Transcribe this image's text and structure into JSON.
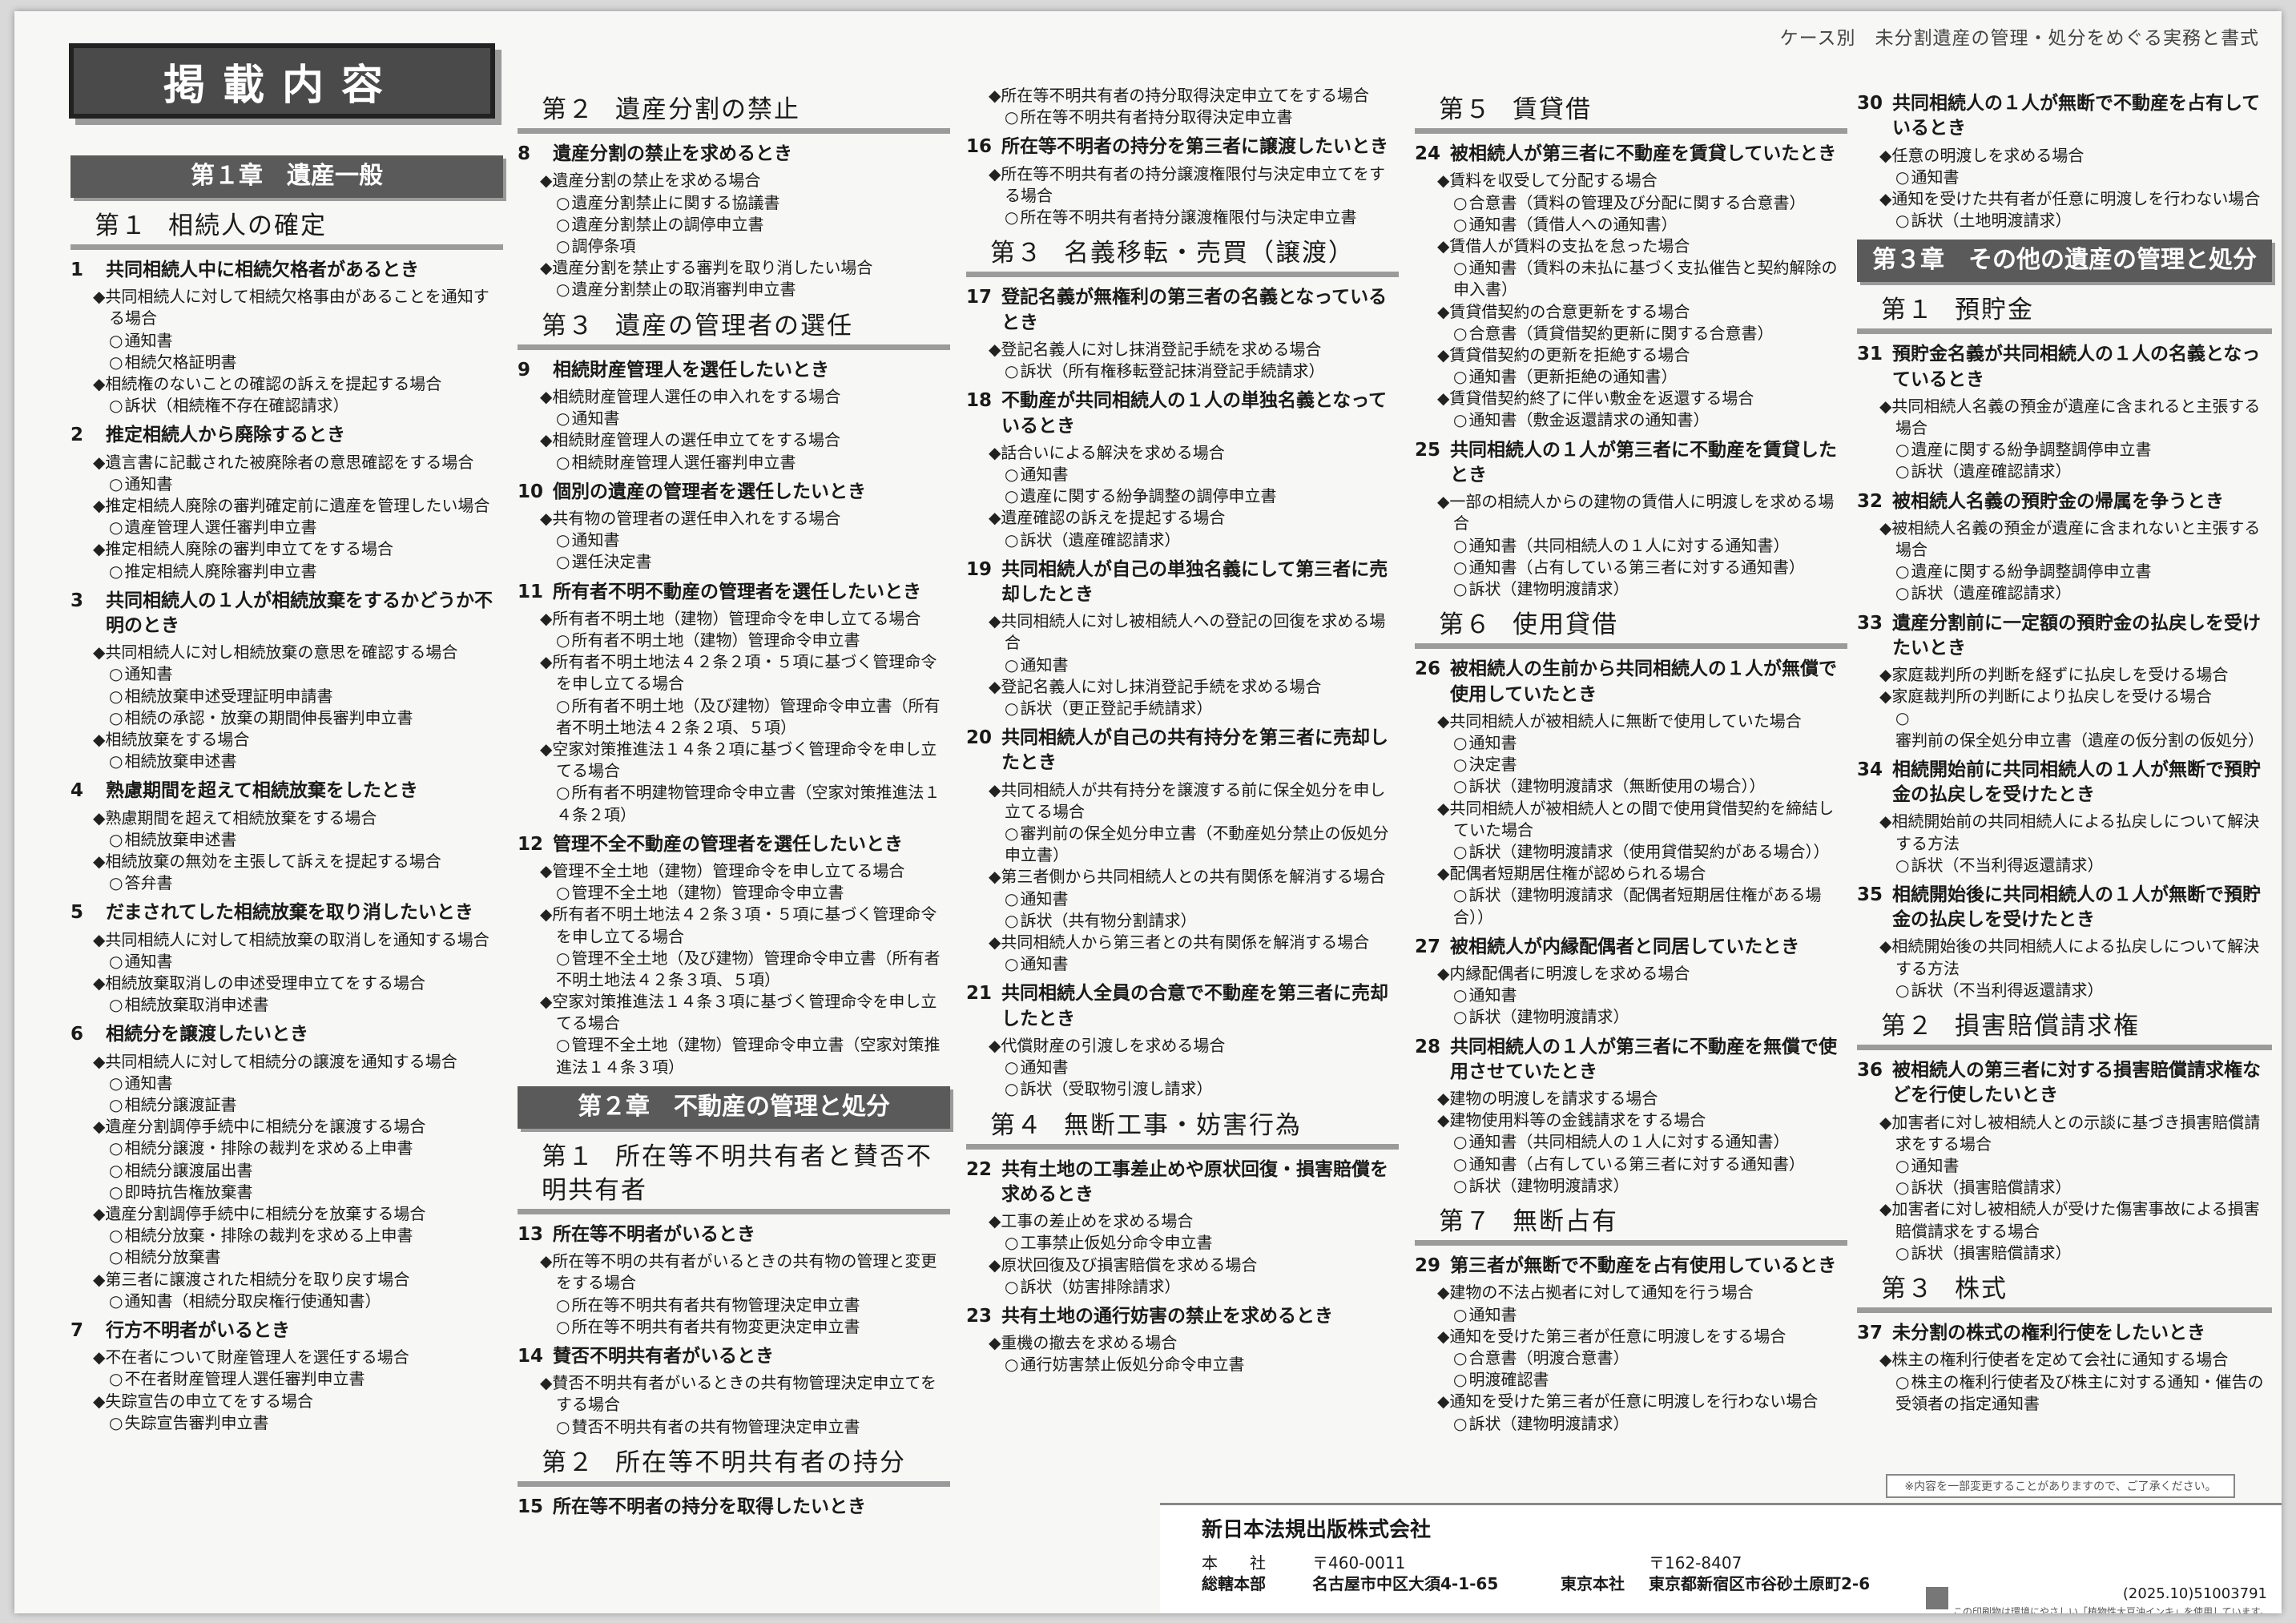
{
  "header": {
    "running_title": "ケース別　未分割遺産の管理・処分をめぐる実務と書式",
    "contents_title": "掲載内容"
  },
  "columns": [
    [
      {
        "type": "chapter",
        "text": "第１章　遺産一般"
      },
      {
        "type": "section",
        "num": "第１",
        "text": "相続人の確定"
      },
      {
        "type": "topic",
        "no": "1",
        "text": "共同相続人中に相続欠格者があるとき"
      },
      {
        "type": "item",
        "text": "共同相続人に対して相続欠格事由があることを通知する場合"
      },
      {
        "type": "doc",
        "text": "通知書"
      },
      {
        "type": "doc",
        "text": "相続欠格証明書"
      },
      {
        "type": "item",
        "text": "相続権のないことの確認の訴えを提起する場合"
      },
      {
        "type": "doc",
        "text": "訴状（相続権不存在確認請求）"
      },
      {
        "type": "topic",
        "no": "2",
        "text": "推定相続人から廃除するとき"
      },
      {
        "type": "item",
        "text": "遺言書に記載された被廃除者の意思確認をする場合"
      },
      {
        "type": "doc",
        "text": "通知書"
      },
      {
        "type": "item",
        "text": "推定相続人廃除の審判確定前に遺産を管理したい場合"
      },
      {
        "type": "doc",
        "text": "遺産管理人選任審判申立書"
      },
      {
        "type": "item",
        "text": "推定相続人廃除の審判申立てをする場合"
      },
      {
        "type": "doc",
        "text": "推定相続人廃除審判申立書"
      },
      {
        "type": "topic",
        "no": "3",
        "text": "共同相続人の１人が相続放棄をするかどうか不明のとき"
      },
      {
        "type": "item",
        "text": "共同相続人に対し相続放棄の意思を確認する場合"
      },
      {
        "type": "doc",
        "text": "通知書"
      },
      {
        "type": "doc",
        "text": "相続放棄申述受理証明申請書"
      },
      {
        "type": "doc",
        "text": "相続の承認・放棄の期間伸長審判申立書"
      },
      {
        "type": "item",
        "text": "相続放棄をする場合"
      },
      {
        "type": "doc",
        "text": "相続放棄申述書"
      },
      {
        "type": "topic",
        "no": "4",
        "text": "熟慮期間を超えて相続放棄をしたとき"
      },
      {
        "type": "item",
        "text": "熟慮期間を超えて相続放棄をする場合"
      },
      {
        "type": "doc",
        "text": "相続放棄申述書"
      },
      {
        "type": "item",
        "text": "相続放棄の無効を主張して訴えを提起する場合"
      },
      {
        "type": "doc",
        "text": "答弁書"
      },
      {
        "type": "topic",
        "no": "5",
        "text": "だまされてした相続放棄を取り消したいとき"
      },
      {
        "type": "item",
        "text": "共同相続人に対して相続放棄の取消しを通知する場合"
      },
      {
        "type": "doc",
        "text": "通知書"
      },
      {
        "type": "item",
        "text": "相続放棄取消しの申述受理申立てをする場合"
      },
      {
        "type": "doc",
        "text": "相続放棄取消申述書"
      },
      {
        "type": "topic",
        "no": "6",
        "text": "相続分を譲渡したいとき"
      },
      {
        "type": "item",
        "text": "共同相続人に対して相続分の譲渡を通知する場合"
      },
      {
        "type": "doc",
        "text": "通知書"
      },
      {
        "type": "doc",
        "text": "相続分譲渡証書"
      },
      {
        "type": "item",
        "text": "遺産分割調停手続中に相続分を譲渡する場合"
      },
      {
        "type": "doc",
        "text": "相続分譲渡・排除の裁判を求める上申書"
      },
      {
        "type": "doc",
        "text": "相続分譲渡届出書"
      },
      {
        "type": "doc",
        "text": "即時抗告権放棄書"
      },
      {
        "type": "item",
        "text": "遺産分割調停手続中に相続分を放棄する場合"
      },
      {
        "type": "doc",
        "text": "相続分放棄・排除の裁判を求める上申書"
      },
      {
        "type": "doc",
        "text": "相続分放棄書"
      },
      {
        "type": "item",
        "text": "第三者に譲渡された相続分を取り戻す場合"
      },
      {
        "type": "doc",
        "text": "通知書（相続分取戻権行使通知書）"
      },
      {
        "type": "topic",
        "no": "7",
        "text": "行方不明者がいるとき"
      },
      {
        "type": "item",
        "text": "不在者について財産管理人を選任する場合"
      },
      {
        "type": "doc",
        "text": "不在者財産管理人選任審判申立書"
      },
      {
        "type": "item",
        "text": "失踪宣告の申立てをする場合"
      },
      {
        "type": "doc",
        "text": "失踪宣告審判申立書"
      }
    ],
    [
      {
        "type": "section",
        "num": "第２",
        "text": "遺産分割の禁止"
      },
      {
        "type": "topic",
        "no": "8",
        "text": "遺産分割の禁止を求めるとき"
      },
      {
        "type": "item",
        "text": "遺産分割の禁止を求める場合"
      },
      {
        "type": "doc",
        "text": "遺産分割禁止に関する協議書"
      },
      {
        "type": "doc",
        "text": "遺産分割禁止の調停申立書"
      },
      {
        "type": "doc",
        "text": "調停条項"
      },
      {
        "type": "item",
        "text": "遺産分割を禁止する審判を取り消したい場合"
      },
      {
        "type": "doc",
        "text": "遺産分割禁止の取消審判申立書"
      },
      {
        "type": "section",
        "num": "第３",
        "text": "遺産の管理者の選任"
      },
      {
        "type": "topic",
        "no": "9",
        "text": "相続財産管理人を選任したいとき"
      },
      {
        "type": "item",
        "text": "相続財産管理人選任の申入れをする場合"
      },
      {
        "type": "doc",
        "text": "通知書"
      },
      {
        "type": "item",
        "text": "相続財産管理人の選任申立てをする場合"
      },
      {
        "type": "doc",
        "text": "相続財産管理人選任審判申立書"
      },
      {
        "type": "topic",
        "no": "10",
        "text": "個別の遺産の管理者を選任したいとき"
      },
      {
        "type": "item",
        "text": "共有物の管理者の選任申入れをする場合"
      },
      {
        "type": "doc",
        "text": "通知書"
      },
      {
        "type": "doc",
        "text": "選任決定書"
      },
      {
        "type": "topic",
        "no": "11",
        "text": "所有者不明不動産の管理者を選任したいとき"
      },
      {
        "type": "item",
        "text": "所有者不明土地（建物）管理命令を申し立てる場合"
      },
      {
        "type": "doc",
        "text": "所有者不明土地（建物）管理命令申立書"
      },
      {
        "type": "item",
        "text": "所有者不明土地法４２条２項・５項に基づく管理命令を申し立てる場合"
      },
      {
        "type": "doc",
        "text": "所有者不明土地（及び建物）管理命令申立書（所有者不明土地法４２条２項、５項）"
      },
      {
        "type": "item",
        "text": "空家対策推進法１４条２項に基づく管理命令を申し立てる場合"
      },
      {
        "type": "doc",
        "text": "所有者不明建物管理命令申立書（空家対策推進法１４条２項）"
      },
      {
        "type": "topic",
        "no": "12",
        "text": "管理不全不動産の管理者を選任したいとき"
      },
      {
        "type": "item",
        "text": "管理不全土地（建物）管理命令を申し立てる場合"
      },
      {
        "type": "doc",
        "text": "管理不全土地（建物）管理命令申立書"
      },
      {
        "type": "item",
        "text": "所有者不明土地法４２条３項・５項に基づく管理命令を申し立てる場合"
      },
      {
        "type": "doc",
        "text": "管理不全土地（及び建物）管理命令申立書（所有者不明土地法４２条３項、５項）"
      },
      {
        "type": "item",
        "text": "空家対策推進法１４条３項に基づく管理命令を申し立てる場合"
      },
      {
        "type": "doc",
        "text": "管理不全土地（建物）管理命令申立書（空家対策推進法１４条３項）"
      },
      {
        "type": "chapter",
        "text": "第２章　不動産の管理と処分"
      },
      {
        "type": "section",
        "num": "第１",
        "text": "所在等不明共有者と賛否不明共有者"
      },
      {
        "type": "topic",
        "no": "13",
        "text": "所在等不明者がいるとき"
      },
      {
        "type": "item",
        "text": "所在等不明の共有者がいるときの共有物の管理と変更をする場合"
      },
      {
        "type": "doc",
        "text": "所在等不明共有者共有物管理決定申立書"
      },
      {
        "type": "doc",
        "text": "所在等不明共有者共有物変更決定申立書"
      },
      {
        "type": "topic",
        "no": "14",
        "text": "賛否不明共有者がいるとき"
      },
      {
        "type": "item",
        "text": "賛否不明共有者がいるときの共有物管理決定申立てをする場合"
      },
      {
        "type": "doc",
        "text": "賛否不明共有者の共有物管理決定申立書"
      },
      {
        "type": "section",
        "num": "第２",
        "text": "所在等不明共有者の持分"
      },
      {
        "type": "topic",
        "no": "15",
        "text": "所在等不明者の持分を取得したいとき"
      }
    ],
    [
      {
        "type": "item",
        "text": "所在等不明共有者の持分取得決定申立てをする場合"
      },
      {
        "type": "doc",
        "text": "所在等不明共有者持分取得決定申立書"
      },
      {
        "type": "topic",
        "no": "16",
        "text": "所在等不明者の持分を第三者に譲渡したいとき"
      },
      {
        "type": "item",
        "text": "所在等不明共有者の持分譲渡権限付与決定申立てをする場合"
      },
      {
        "type": "doc",
        "text": "所在等不明共有者持分譲渡権限付与決定申立書"
      },
      {
        "type": "section",
        "num": "第３",
        "text": "名義移転・売買（譲渡）"
      },
      {
        "type": "topic",
        "no": "17",
        "text": "登記名義が無権利の第三者の名義となっているとき"
      },
      {
        "type": "item",
        "text": "登記名義人に対し抹消登記手続を求める場合"
      },
      {
        "type": "doc",
        "text": "訴状（所有権移転登記抹消登記手続請求）"
      },
      {
        "type": "topic",
        "no": "18",
        "text": "不動産が共同相続人の１人の単独名義となっているとき"
      },
      {
        "type": "item",
        "text": "話合いによる解決を求める場合"
      },
      {
        "type": "doc",
        "text": "通知書"
      },
      {
        "type": "doc",
        "text": "遺産に関する紛争調整の調停申立書"
      },
      {
        "type": "item",
        "text": "遺産確認の訴えを提起する場合"
      },
      {
        "type": "doc",
        "text": "訴状（遺産確認請求）"
      },
      {
        "type": "topic",
        "no": "19",
        "text": "共同相続人が自己の単独名義にして第三者に売却したとき"
      },
      {
        "type": "item",
        "text": "共同相続人に対し被相続人への登記の回復を求める場合"
      },
      {
        "type": "doc",
        "text": "通知書"
      },
      {
        "type": "item",
        "text": "登記名義人に対し抹消登記手続を求める場合"
      },
      {
        "type": "doc",
        "text": "訴状（更正登記手続請求）"
      },
      {
        "type": "topic",
        "no": "20",
        "text": "共同相続人が自己の共有持分を第三者に売却したとき"
      },
      {
        "type": "item",
        "text": "共同相続人が共有持分を譲渡する前に保全処分を申し立てる場合"
      },
      {
        "type": "doc",
        "text": "審判前の保全処分申立書（不動産処分禁止の仮処分申立書）"
      },
      {
        "type": "item",
        "text": "第三者側から共同相続人との共有関係を解消する場合"
      },
      {
        "type": "doc",
        "text": "通知書"
      },
      {
        "type": "doc",
        "text": "訴状（共有物分割請求）"
      },
      {
        "type": "item",
        "text": "共同相続人から第三者との共有関係を解消する場合"
      },
      {
        "type": "doc",
        "text": "通知書"
      },
      {
        "type": "topic",
        "no": "21",
        "text": "共同相続人全員の合意で不動産を第三者に売却したとき"
      },
      {
        "type": "item",
        "text": "代償財産の引渡しを求める場合"
      },
      {
        "type": "doc",
        "text": "通知書"
      },
      {
        "type": "doc",
        "text": "訴状（受取物引渡し請求）"
      },
      {
        "type": "section",
        "num": "第４",
        "text": "無断工事・妨害行為"
      },
      {
        "type": "topic",
        "no": "22",
        "text": "共有土地の工事差止めや原状回復・損害賠償を求めるとき"
      },
      {
        "type": "item",
        "text": "工事の差止めを求める場合"
      },
      {
        "type": "doc",
        "text": "工事禁止仮処分命令申立書"
      },
      {
        "type": "item",
        "text": "原状回復及び損害賠償を求める場合"
      },
      {
        "type": "doc",
        "text": "訴状（妨害排除請求）"
      },
      {
        "type": "topic",
        "no": "23",
        "text": "共有土地の通行妨害の禁止を求めるとき"
      },
      {
        "type": "item",
        "text": "重機の撤去を求める場合"
      },
      {
        "type": "doc",
        "text": "通行妨害禁止仮処分命令申立書"
      }
    ],
    [
      {
        "type": "section",
        "num": "第５",
        "text": "賃貸借"
      },
      {
        "type": "topic",
        "no": "24",
        "text": "被相続人が第三者に不動産を賃貸していたとき"
      },
      {
        "type": "item",
        "text": "賃料を収受して分配する場合"
      },
      {
        "type": "doc",
        "text": "合意書（賃料の管理及び分配に関する合意書）"
      },
      {
        "type": "doc",
        "text": "通知書（賃借人への通知書）"
      },
      {
        "type": "item",
        "text": "賃借人が賃料の支払を怠った場合"
      },
      {
        "type": "doc",
        "text": "通知書（賃料の未払に基づく支払催告と契約解除の申入書）"
      },
      {
        "type": "item",
        "text": "賃貸借契約の合意更新をする場合"
      },
      {
        "type": "doc",
        "text": "合意書（賃貸借契約更新に関する合意書）"
      },
      {
        "type": "item",
        "text": "賃貸借契約の更新を拒絶する場合"
      },
      {
        "type": "doc",
        "text": "通知書（更新拒絶の通知書）"
      },
      {
        "type": "item",
        "text": "賃貸借契約終了に伴い敷金を返還する場合"
      },
      {
        "type": "doc",
        "text": "通知書（敷金返還請求の通知書）"
      },
      {
        "type": "topic",
        "no": "25",
        "text": "共同相続人の１人が第三者に不動産を賃貸したとき"
      },
      {
        "type": "item",
        "text": "一部の相続人からの建物の賃借人に明渡しを求める場合"
      },
      {
        "type": "doc",
        "text": "通知書（共同相続人の１人に対する通知書）"
      },
      {
        "type": "doc",
        "text": "通知書（占有している第三者に対する通知書）"
      },
      {
        "type": "doc",
        "text": "訴状（建物明渡請求）"
      },
      {
        "type": "section",
        "num": "第６",
        "text": "使用貸借"
      },
      {
        "type": "topic",
        "no": "26",
        "text": "被相続人の生前から共同相続人の１人が無償で使用していたとき"
      },
      {
        "type": "item",
        "text": "共同相続人が被相続人に無断で使用していた場合"
      },
      {
        "type": "doc",
        "text": "通知書"
      },
      {
        "type": "doc",
        "text": "決定書"
      },
      {
        "type": "doc",
        "text": "訴状（建物明渡請求（無断使用の場合））"
      },
      {
        "type": "item",
        "text": "共同相続人が被相続人との間で使用貸借契約を締結していた場合"
      },
      {
        "type": "doc",
        "text": "訴状（建物明渡請求（使用貸借契約がある場合））"
      },
      {
        "type": "item",
        "text": "配偶者短期居住権が認められる場合"
      },
      {
        "type": "doc",
        "text": "訴状（建物明渡請求（配偶者短期居住権がある場合））"
      },
      {
        "type": "topic",
        "no": "27",
        "text": "被相続人が内縁配偶者と同居していたとき"
      },
      {
        "type": "item",
        "text": "内縁配偶者に明渡しを求める場合"
      },
      {
        "type": "doc",
        "text": "通知書"
      },
      {
        "type": "doc",
        "text": "訴状（建物明渡請求）"
      },
      {
        "type": "topic",
        "no": "28",
        "text": "共同相続人の１人が第三者に不動産を無償で使用させていたとき"
      },
      {
        "type": "item",
        "text": "建物の明渡しを請求する場合"
      },
      {
        "type": "item",
        "text": "建物使用料等の金銭請求をする場合"
      },
      {
        "type": "doc",
        "text": "通知書（共同相続人の１人に対する通知書）"
      },
      {
        "type": "doc",
        "text": "通知書（占有している第三者に対する通知書）"
      },
      {
        "type": "doc",
        "text": "訴状（建物明渡請求）"
      },
      {
        "type": "section",
        "num": "第７",
        "text": "無断占有"
      },
      {
        "type": "topic",
        "no": "29",
        "text": "第三者が無断で不動産を占有使用しているとき"
      },
      {
        "type": "item",
        "text": "建物の不法占拠者に対して通知を行う場合"
      },
      {
        "type": "doc",
        "text": "通知書"
      },
      {
        "type": "item",
        "text": "通知を受けた第三者が任意に明渡しをする場合"
      },
      {
        "type": "doc",
        "text": "合意書（明渡合意書）"
      },
      {
        "type": "doc",
        "text": "明渡確認書"
      },
      {
        "type": "item",
        "text": "通知を受けた第三者が任意に明渡しを行わない場合"
      },
      {
        "type": "doc",
        "text": "訴状（建物明渡請求）"
      }
    ],
    [
      {
        "type": "topic",
        "no": "30",
        "text": "共同相続人の１人が無断で不動産を占有しているとき"
      },
      {
        "type": "item",
        "text": "任意の明渡しを求める場合"
      },
      {
        "type": "doc",
        "text": "通知書"
      },
      {
        "type": "item",
        "text": "通知を受けた共有者が任意に明渡しを行わない場合"
      },
      {
        "type": "doc",
        "text": "訴状（土地明渡請求）"
      },
      {
        "type": "chapter",
        "text": "第３章　その他の遺産の管理と処分"
      },
      {
        "type": "section",
        "num": "第１",
        "text": "預貯金"
      },
      {
        "type": "topic",
        "no": "31",
        "text": "預貯金名義が共同相続人の１人の名義となっているとき"
      },
      {
        "type": "item",
        "text": "共同相続人名義の預金が遺産に含まれると主張する場合"
      },
      {
        "type": "doc",
        "text": "遺産に関する紛争調整調停申立書"
      },
      {
        "type": "doc",
        "text": "訴状（遺産確認請求）"
      },
      {
        "type": "topic",
        "no": "32",
        "text": "被相続人名義の預貯金の帰属を争うとき"
      },
      {
        "type": "item",
        "text": "被相続人名義の預金が遺産に含まれないと主張する場合"
      },
      {
        "type": "doc",
        "text": "遺産に関する紛争調整調停申立書"
      },
      {
        "type": "doc",
        "text": "訴状（遺産確認請求）"
      },
      {
        "type": "topic",
        "no": "33",
        "text": "遺産分割前に一定額の預貯金の払戻しを受けたいとき"
      },
      {
        "type": "item",
        "text": "家庭裁判所の判断を経ずに払戻しを受ける場合"
      },
      {
        "type": "item",
        "text": "家庭裁判所の判断により払戻しを受ける場合"
      },
      {
        "type": "doc",
        "text": "審判前の保全処分申立書（遺産の仮分割の仮処分）"
      },
      {
        "type": "topic",
        "no": "34",
        "text": "相続開始前に共同相続人の１人が無断で預貯金の払戻しを受けたとき"
      },
      {
        "type": "item",
        "text": "相続開始前の共同相続人による払戻しについて解決する方法"
      },
      {
        "type": "doc",
        "text": "訴状（不当利得返還請求）"
      },
      {
        "type": "topic",
        "no": "35",
        "text": "相続開始後に共同相続人の１人が無断で預貯金の払戻しを受けたとき"
      },
      {
        "type": "item",
        "text": "相続開始後の共同相続人による払戻しについて解決する方法"
      },
      {
        "type": "doc",
        "text": "訴状（不当利得返還請求）"
      },
      {
        "type": "section",
        "num": "第２",
        "text": "損害賠償請求権"
      },
      {
        "type": "topic",
        "no": "36",
        "text": "被相続人の第三者に対する損害賠償請求権などを行使したいとき"
      },
      {
        "type": "item",
        "text": "加害者に対し被相続人との示談に基づき損害賠償請求をする場合"
      },
      {
        "type": "doc",
        "text": "通知書"
      },
      {
        "type": "doc",
        "text": "訴状（損害賠償請求）"
      },
      {
        "type": "item",
        "text": "加害者に対し被相続人が受けた傷害事故による損害賠償請求をする場合"
      },
      {
        "type": "doc",
        "text": "訴状（損害賠償請求）"
      },
      {
        "type": "section",
        "num": "第３",
        "text": "株式"
      },
      {
        "type": "topic",
        "no": "37",
        "text": "未分割の株式の権利行使をしたいとき"
      },
      {
        "type": "item",
        "text": "株主の権利行使者を定めて会社に通知する場合"
      },
      {
        "type": "doc",
        "text": "株主の権利行使者及び株主に対する通知・催告の受領者の指定通知書"
      }
    ]
  ],
  "notice": "※内容を一部変更することがありますので、ご了承ください。",
  "footer": {
    "publisher": "新日本法規出版株式会社",
    "honsha_label": "本　　社",
    "sohonbu_label": "総轄本部",
    "nagoya_zip": "〒460-0011",
    "nagoya_addr": "名古屋市中区大須4-1-65",
    "tokyo_label": "東京本社",
    "tokyo_zip": "〒162-8407",
    "tokyo_addr": "東京都新宿区市谷砂土原町2-6",
    "code": "(2025.10)51003791",
    "eco_note": "この印刷物は環境にやさしい「植物性大豆油インキ」を使用しています。"
  },
  "colors": {
    "chapter_bg": "#5a5a5a",
    "section_rule": "#9b9b9b",
    "page_bg": "#f7f7f5"
  }
}
